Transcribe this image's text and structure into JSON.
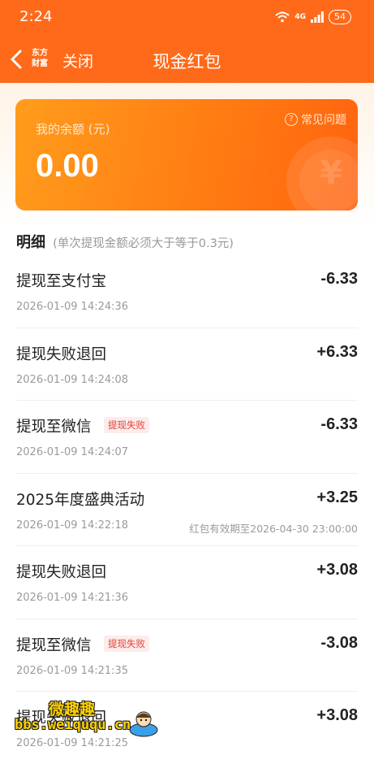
{
  "status_bar": {
    "time": "2:24",
    "network": "4G",
    "battery": "54"
  },
  "nav": {
    "brand_line1": "东方",
    "brand_line2": "财富",
    "close_label": "关闭",
    "title": "现金红包"
  },
  "balance": {
    "label": "我的余额 (元)",
    "value": "0.00",
    "faq_label": "常见问题"
  },
  "detail": {
    "title": "明细",
    "note": "(单次提现金额必须大于等于0.3元)"
  },
  "transactions": [
    {
      "title": "提现至支付宝",
      "badge": "",
      "time": "2026-01-09 14:24:36",
      "amount": "-6.33",
      "expiry": ""
    },
    {
      "title": "提现失败退回",
      "badge": "",
      "time": "2026-01-09 14:24:08",
      "amount": "+6.33",
      "expiry": ""
    },
    {
      "title": "提现至微信",
      "badge": "提现失败",
      "time": "2026-01-09 14:24:07",
      "amount": "-6.33",
      "expiry": ""
    },
    {
      "title": "2025年度盛典活动",
      "badge": "",
      "time": "2026-01-09 14:22:18",
      "amount": "+3.25",
      "expiry": "红包有效期至2026-04-30 23:00:00"
    },
    {
      "title": "提现失败退回",
      "badge": "",
      "time": "2026-01-09 14:21:36",
      "amount": "+3.08",
      "expiry": ""
    },
    {
      "title": "提现至微信",
      "badge": "提现失败",
      "time": "2026-01-09 14:21:35",
      "amount": "-3.08",
      "expiry": ""
    },
    {
      "title": "提现失败退回",
      "badge": "",
      "time": "2026-01-09 14:21:25",
      "amount": "+3.08",
      "expiry": ""
    }
  ],
  "watermark": {
    "line1": "微趣趣",
    "line2": "bbs.weiququ.cn"
  },
  "colors": {
    "header": "#ff6a1a",
    "card_start": "#ff9c1c",
    "card_end": "#ff6410",
    "badge_text": "#e0403a",
    "badge_bg": "#fdecea"
  }
}
